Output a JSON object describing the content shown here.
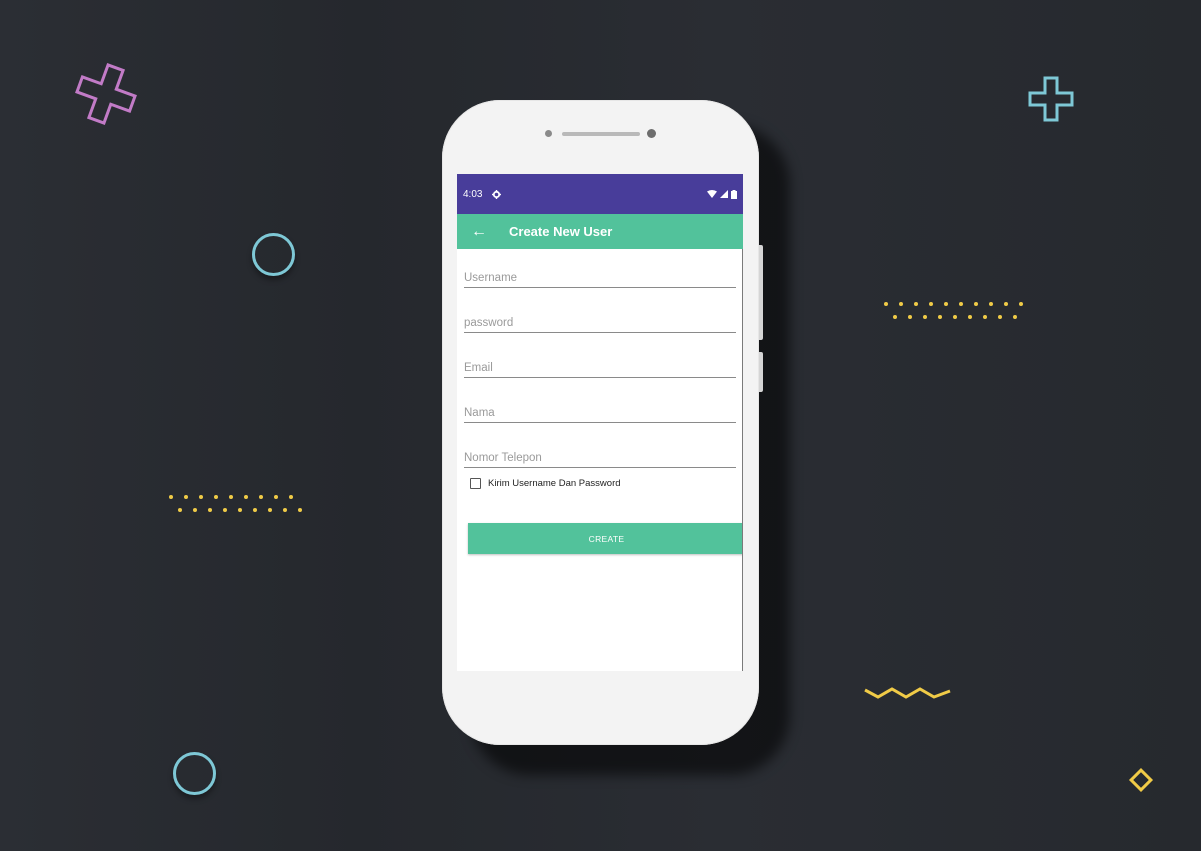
{
  "status_bar": {
    "time": "4:03",
    "settings_icon": "gear-icon",
    "wifi_icon": "wifi-icon",
    "signal_icon": "signal-icon",
    "battery_icon": "battery-icon"
  },
  "app_bar": {
    "back_icon": "back-arrow-icon",
    "back_glyph": "←",
    "title": "Create New User"
  },
  "form": {
    "fields": [
      {
        "placeholder": "Username",
        "value": ""
      },
      {
        "placeholder": "password",
        "value": ""
      },
      {
        "placeholder": "Email",
        "value": ""
      },
      {
        "placeholder": "Nama",
        "value": ""
      },
      {
        "placeholder": "Nomor Telepon",
        "value": ""
      }
    ],
    "checkbox_label": "Kirim Username Dan Password",
    "checkbox_checked": false,
    "create_label": "CREATE"
  },
  "colors": {
    "status_bar": "#483d9a",
    "accent": "#52c29b",
    "background": "#2a2d33",
    "deco_pink": "#c27bc7",
    "deco_cyan": "#7ec8d6",
    "deco_yellow": "#f0cb47"
  }
}
